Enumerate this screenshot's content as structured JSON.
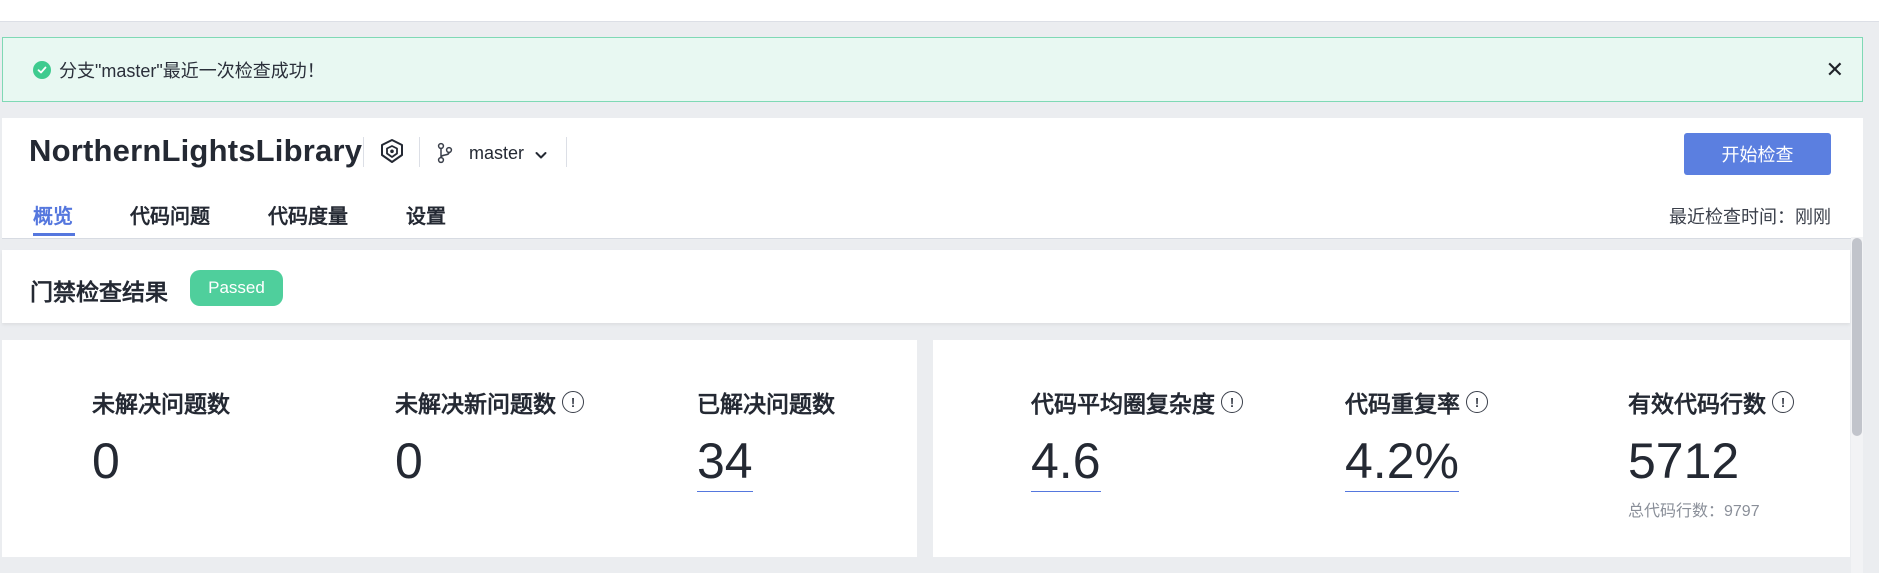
{
  "alert": {
    "message": "分支\"master\"最近一次检查成功！",
    "close_label": "✕"
  },
  "repo": {
    "name": "NorthernLightsLibrary",
    "branch": "master"
  },
  "toolbar": {
    "start_label": "开始检查"
  },
  "tabs": [
    {
      "label": "概览",
      "active": true
    },
    {
      "label": "代码问题",
      "active": false
    },
    {
      "label": "代码度量",
      "active": false
    },
    {
      "label": "设置",
      "active": false
    }
  ],
  "last_check": "最近检查时间：刚刚",
  "gate": {
    "title": "门禁检查结果",
    "status": "Passed"
  },
  "issues": [
    {
      "label": "未解决问题数",
      "value": "0",
      "has_info": false
    },
    {
      "label": "未解决新问题数",
      "value": "0",
      "has_info": true
    },
    {
      "label": "已解决问题数",
      "value": "34",
      "has_info": false
    }
  ],
  "metrics": [
    {
      "label": "代码平均圈复杂度",
      "value": "4.6",
      "has_info": true
    },
    {
      "label": "代码重复率",
      "value": "4.2%",
      "has_info": true
    },
    {
      "label": "有效代码行数",
      "value": "5712",
      "has_info": true,
      "sub": "总代码行数：9797"
    }
  ],
  "icons": {
    "info_glyph": "!"
  },
  "colors": {
    "accent": "#5577de",
    "button": "#5b7fe0",
    "success": "#4fcf9c",
    "alert_bg": "#e8f8f2"
  }
}
